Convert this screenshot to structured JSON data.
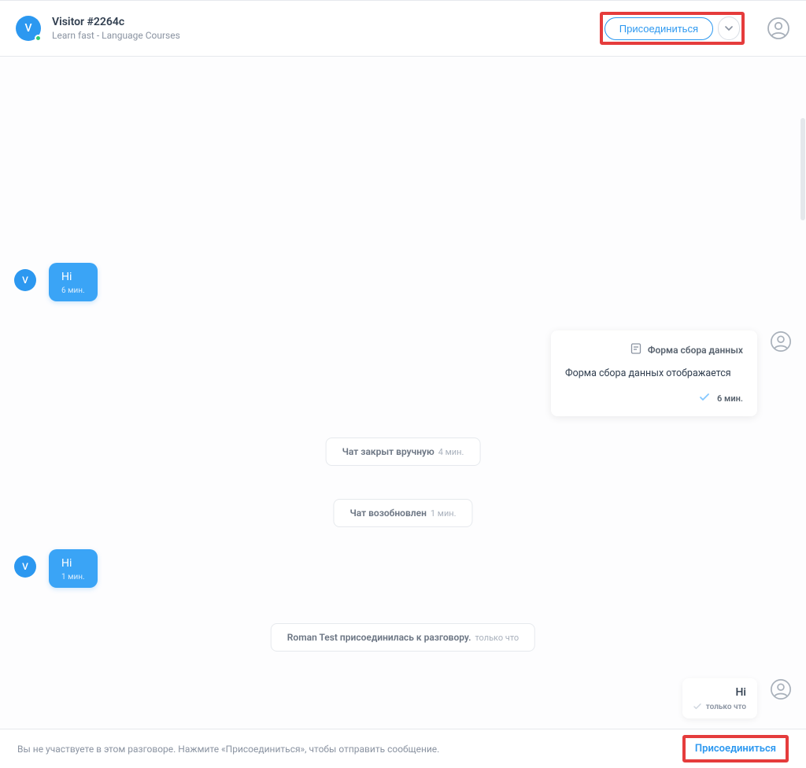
{
  "header": {
    "avatar_letter": "V",
    "visitor_name": "Visitor #2264c",
    "visitor_sub": "Learn fast - Language Courses",
    "join_label": "Присоединиться"
  },
  "messages": {
    "v1": {
      "text": "Hi",
      "time": "6 мин."
    },
    "form": {
      "title": "Форма сбора данных",
      "body": "Форма сбора данных отображается",
      "time": "6 мин."
    },
    "sys_closed": {
      "bold": "Чат закрыт вручную",
      "time": "4 мин."
    },
    "sys_resumed": {
      "bold": "Чат возобновлен",
      "time": "1 мин."
    },
    "v2": {
      "text": "Hi",
      "time": "1 мин."
    },
    "sys_joined": {
      "bold": "Roman Test присоединилась к разговору.",
      "time": "только что"
    },
    "a1": {
      "text": "Hi",
      "time": "только что"
    }
  },
  "footer": {
    "note": "Вы не участвуете в этом разговоре. Нажмите «Присоединиться», чтобы отправить сообщение.",
    "join_label": "Присоединиться"
  }
}
